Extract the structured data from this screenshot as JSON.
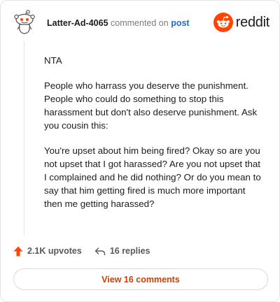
{
  "header": {
    "author": "Latter-Ad-4065",
    "commented_on": "commented on",
    "post_link": "post",
    "brand": "reddit"
  },
  "comment": {
    "paragraphs": [
      "NTA",
      "People who harrass you deserve the punishment. People who could do something to stop this harassment but don't also deserve punishment. Ask you cousin this:",
      "You're upset about him being fired? Okay so are you not upset that I got harassed? Are you not upset that I complained and he did nothing? Or do you mean to say that him getting fired is much more important then me getting harassed?"
    ]
  },
  "actions": {
    "upvotes": "2.1K upvotes",
    "replies": "16 replies"
  },
  "view_button": "View 16 comments",
  "colors": {
    "brand_orange": "#ff4500",
    "link_blue": "#1a6fc9",
    "button_text": "#d93a00"
  },
  "icons": [
    "snoo-avatar-icon",
    "reddit-logo-icon",
    "upvote-arrow-icon",
    "reply-arrow-icon"
  ]
}
